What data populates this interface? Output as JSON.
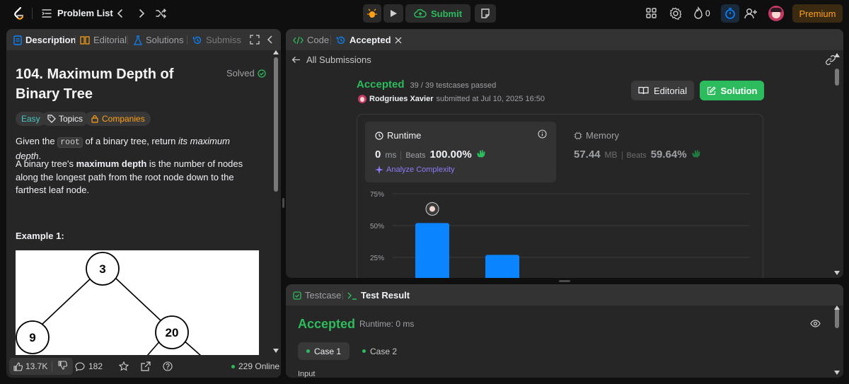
{
  "nav": {
    "problem_list": "Problem List",
    "submit": "Submit",
    "streak": "0",
    "premium": "Premium"
  },
  "left": {
    "tabs": [
      "Description",
      "Editorial",
      "Solutions",
      "Submiss"
    ],
    "title": "104. Maximum Depth of Binary Tree",
    "solved": "Solved",
    "chips": [
      "Easy",
      "Topics",
      "Companies"
    ],
    "desc": {
      "p1_a": "Given the ",
      "p1_code": "root",
      "p1_b": " of a binary tree, return ",
      "p1_em": "its maximum depth",
      "p1_c": ".",
      "p2_a": "A binary tree's ",
      "p2_b": "maximum depth",
      "p2_c": " is the number of nodes along the longest path from the root node down to the farthest leaf node."
    },
    "example_title": "Example 1:",
    "tree_nodes": [
      "3",
      "9",
      "20"
    ],
    "likes": "13.7K",
    "comments": "182",
    "online": "229 Online"
  },
  "right_top": {
    "tabs": [
      "Code",
      "Accepted"
    ],
    "all_submissions": "All Submissions",
    "status": "Accepted",
    "testcases": "39 / 39 testcases passed",
    "author": "Rodgriues Xavier",
    "submitted": "submitted at Jul 10, 2025 16:50",
    "editorial_btn": "Editorial",
    "solution_btn": "Solution",
    "runtime": {
      "label": "Runtime",
      "value": "0",
      "unit": "ms",
      "beats_label": "Beats",
      "beats": "100.00%"
    },
    "memory": {
      "label": "Memory",
      "value": "57.44",
      "unit": "MB",
      "beats_label": "Beats",
      "beats": "59.64%"
    },
    "analyze": "Analyze Complexity"
  },
  "chart_data": {
    "type": "bar",
    "yticks": [
      "75%",
      "50%",
      "25%"
    ],
    "ylim": [
      0,
      75
    ],
    "values": [
      52,
      27
    ],
    "grid": true
  },
  "right_bottom": {
    "tabs": [
      "Testcase",
      "Test Result"
    ],
    "status": "Accepted",
    "runtime": "Runtime: 0 ms",
    "cases": [
      "Case 1",
      "Case 2"
    ],
    "input_label": "Input"
  },
  "colors": {
    "accent_green": "#2cbb5d",
    "brand_orange": "#ffa116",
    "bar_blue": "#0a84ff",
    "panel_bg": "#262626"
  }
}
